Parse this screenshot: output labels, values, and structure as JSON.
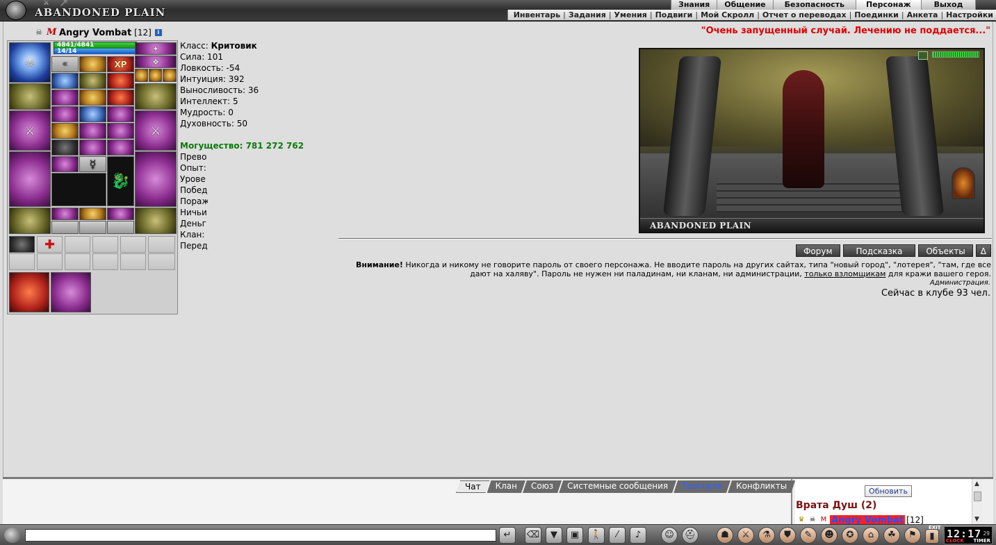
{
  "header": {
    "logo_text": "ABANDONED PLAIN",
    "main_menu": [
      "Знания",
      "Общение",
      "Безопасность",
      "Персонаж",
      "Выход"
    ],
    "active_main": "Персонаж",
    "sub_menu": [
      "Инвентарь",
      "Задания",
      "Умения",
      "Подвиги",
      "Мой Скролл",
      "Отчет о переводах",
      "Поединки",
      "Анкета",
      "Настройки"
    ]
  },
  "character": {
    "name": "Angry Vombat",
    "level": "[12]",
    "info_icon": "i",
    "hp": "4841/4841",
    "mp": "14/14",
    "hp_fraction": 1.0,
    "mp_fraction": 1.0
  },
  "stats": {
    "class_label": "Класс:",
    "class_value": "Критовик",
    "lines": [
      "Сила: 101",
      "Ловкость: -54",
      "Интуиция: 392",
      "Выносливость: 36",
      "Интеллект: 5",
      "Мудрость: 0",
      "Духовность: 50"
    ],
    "power": "Могущество: 781 272 762",
    "lower_lines": [
      "Прево",
      "Опыт:",
      "Урове",
      "Побед",
      "Пораж",
      "Ничьи",
      "Деньг",
      "Клан:",
      "Перед"
    ]
  },
  "quote": "\"Очень запущенный случай. Лечению не поддается...\"",
  "location": {
    "caption": "ABANDONED PLAIN"
  },
  "location_buttons": [
    "Форум",
    "Подсказка",
    "Объекты",
    "Δ"
  ],
  "warning": {
    "bold": "Внимание!",
    "text": " Никогда и никому не говорите пароль от своего персонажа. Не вводите пароль на других сайтах, типа \"новый город\", \"лотерея\", \"там, где все дают на халяву\". Пароль не нужен ни паладинам, ни кланам, ни администрации, ",
    "link": "только взломщикам",
    "tail": " для кражи вашего героя.",
    "signature": "Администрация."
  },
  "online_count": "Сейчас в клубе 93 чел.",
  "chat": {
    "tabs": [
      "Чат",
      "Клан",
      "Союз",
      "Системные сообщения",
      "Торговля",
      "Конфликты"
    ],
    "active_tab": "Чат",
    "input_value": "",
    "refresh_label": "Обновить",
    "room_title": "Врата Душ (2)",
    "online_user_name": "Angry Vombat",
    "online_user_level": "[12]"
  },
  "toolbar": {
    "clock_time": "12:17",
    "clock_sec": "29",
    "clock_label": "CLOCK",
    "timer_label": "TIMER",
    "exit_label": "EXIT"
  },
  "colors": {
    "quote": "#e00000",
    "power": "#0a7a0a",
    "room_title": "#7a1111",
    "trade_tab": "#2f62ff"
  }
}
